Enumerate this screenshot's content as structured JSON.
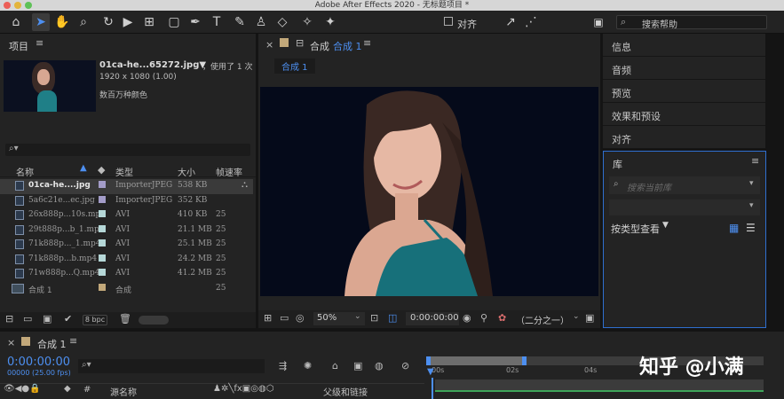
{
  "window": {
    "title": "Adobe After Effects 2020 - 无标题项目 *"
  },
  "toolbar": {
    "snap_label": "对齐",
    "search_placeholder": "搜索帮助"
  },
  "project": {
    "panel_title": "项目",
    "selected_name": "01ca-he...65272.jpg▼",
    "selected_usage": "，使用了 1 次",
    "selected_dims": "1920 x 1080 (1.00)",
    "selected_color": "数百万种颜色",
    "columns": {
      "name": "名称",
      "type": "类型",
      "size": "大小",
      "fps": "帧速率"
    },
    "bpc": "8 bpc",
    "rows": [
      {
        "name": "01ca-he....jpg",
        "type": "ImporterJPEG",
        "size": "538 KB",
        "fps": "",
        "color": "#a39cc8"
      },
      {
        "name": "5a6c21e...ec.jpg",
        "type": "ImporterJPEG",
        "size": "352 KB",
        "fps": "",
        "color": "#a39cc8"
      },
      {
        "name": "26x888p...10s.mp4",
        "type": "AVI",
        "size": "410 KB",
        "fps": "25",
        "color": "#b5d7d7"
      },
      {
        "name": "29t888p...b_1.mp4",
        "type": "AVI",
        "size": "21.1 MB",
        "fps": "25",
        "color": "#b5d7d7"
      },
      {
        "name": "71k888p..._1.mp4",
        "type": "AVI",
        "size": "25.1 MB",
        "fps": "25",
        "color": "#b5d7d7"
      },
      {
        "name": "71k888p...b.mp4",
        "type": "AVI",
        "size": "24.2 MB",
        "fps": "25",
        "color": "#b5d7d7"
      },
      {
        "name": "71w888p...Q.mp4",
        "type": "AVI",
        "size": "41.2 MB",
        "fps": "25",
        "color": "#b5d7d7"
      },
      {
        "name": "合成 1",
        "type": "合成",
        "size": "",
        "fps": "25",
        "color": "#c2a87a"
      }
    ]
  },
  "composition": {
    "panel_label": "合成",
    "comp_name": "合成 1",
    "tab": "合成 1",
    "zoom": "50%",
    "timecode": "0:00:00:00",
    "resolution": "（二分之一）"
  },
  "right_panels": [
    "信息",
    "音频",
    "预览",
    "效果和预设",
    "对齐"
  ],
  "library": {
    "title": "库",
    "search_placeholder": "搜索当前库",
    "view_by": "按类型查看"
  },
  "timeline": {
    "comp_tab": "合成 1",
    "timecode": "0:00:00:00",
    "frames": "00000 (25.00 fps)",
    "col_hash": "#",
    "col_source": "源名称",
    "col_parent": "父级和链接",
    "ruler": [
      "00s",
      "02s",
      "04s"
    ]
  },
  "watermark": "知乎 @小满"
}
